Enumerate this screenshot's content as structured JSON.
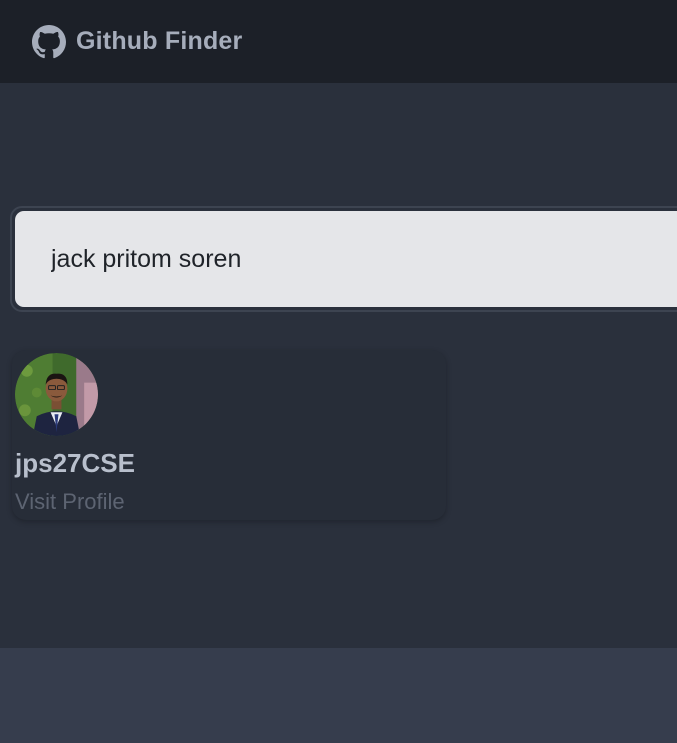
{
  "navbar": {
    "brand_icon": "github-icon",
    "title": "Github Finder"
  },
  "search": {
    "value": "jack pritom soren"
  },
  "results": [
    {
      "username": "jps27CSE",
      "link_label": "Visit Profile",
      "avatar": "avatar-photo"
    }
  ],
  "colors": {
    "navbar_bg": "#1c2028",
    "page_bg": "#2a303c",
    "card_bg": "#272d38",
    "input_bg": "#e5e6e9",
    "footer_bg": "#363d4d",
    "title_text": "#a6adbb",
    "muted_text": "#5d6472"
  }
}
